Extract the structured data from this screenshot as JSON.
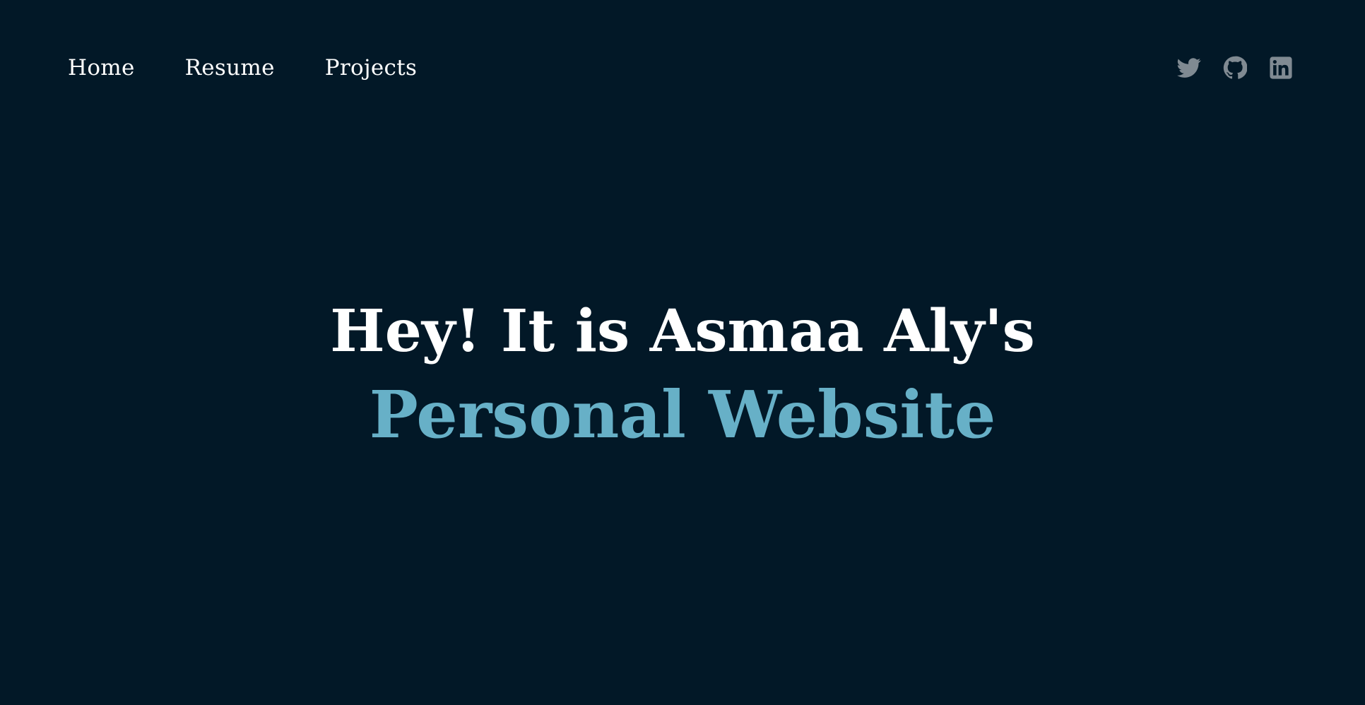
{
  "colors": {
    "background": "#021827",
    "nav_text": "#ffffff",
    "headline_text": "#ffffff",
    "accent": "#67b0c7",
    "social_icon": "#808a92"
  },
  "nav": {
    "items": [
      {
        "label": "Home"
      },
      {
        "label": "Resume"
      },
      {
        "label": "Projects"
      }
    ]
  },
  "socials": [
    {
      "icon": "twitter-icon"
    },
    {
      "icon": "github-icon"
    },
    {
      "icon": "linkedin-icon"
    }
  ],
  "hero": {
    "line1": "Hey! It is Asmaa Aly's",
    "line2": "Personal Website"
  }
}
